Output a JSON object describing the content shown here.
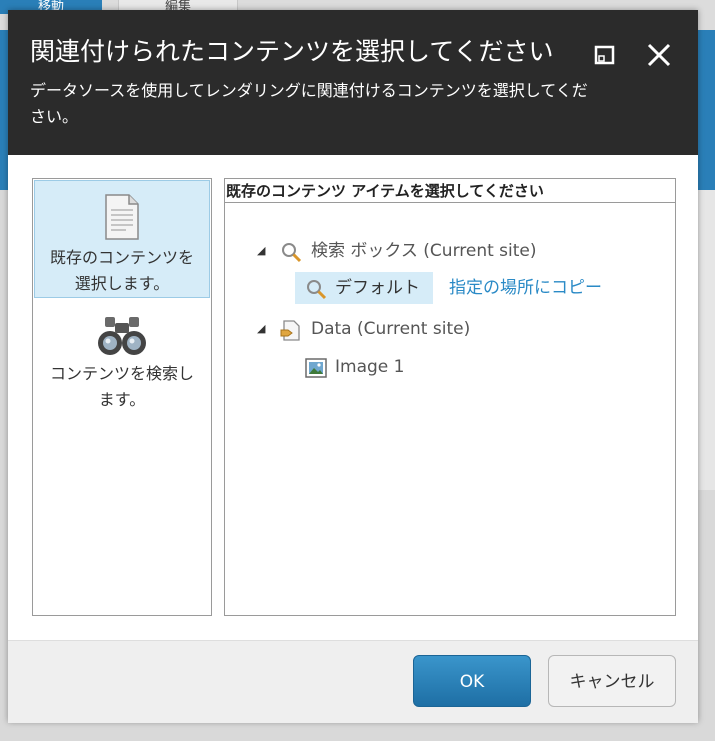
{
  "background": {
    "tabs": [
      {
        "label": "移動"
      },
      {
        "label": "編集"
      }
    ]
  },
  "dialog": {
    "title": "関連付けられたコンテンツを選択してください",
    "subtitle": "データソースを使用してレンダリングに関連付けるコンテンツを選択してください。",
    "maximize_icon": "maximize-icon",
    "close_icon": "close-icon"
  },
  "sources": [
    {
      "label": "既存のコンテンツを選択します。",
      "icon": "document-icon",
      "selected": true
    },
    {
      "label": "コンテンツを検索します。",
      "icon": "binoculars-icon",
      "selected": false
    }
  ],
  "panel": {
    "header": "既存のコンテンツ アイテムを選択してください",
    "tree": [
      {
        "label": "検索 ボックス (Current site)",
        "icon": "search-icon",
        "expanded": true,
        "children": [
          {
            "label": "デフォルト",
            "icon": "search-icon",
            "selected": true,
            "action": "指定の場所にコピー"
          }
        ]
      },
      {
        "label": "Data (Current site)",
        "icon": "data-folder-icon",
        "expanded": true,
        "children": [
          {
            "label": "Image 1",
            "icon": "image-icon",
            "selected": false
          }
        ]
      }
    ]
  },
  "footer": {
    "ok_label": "OK",
    "cancel_label": "キャンセル"
  },
  "colors": {
    "header_bg": "#2b2b2b",
    "selection": "#d6ecf8",
    "accent": "#2a8ac6",
    "ok_button": "#2a7fb8"
  }
}
